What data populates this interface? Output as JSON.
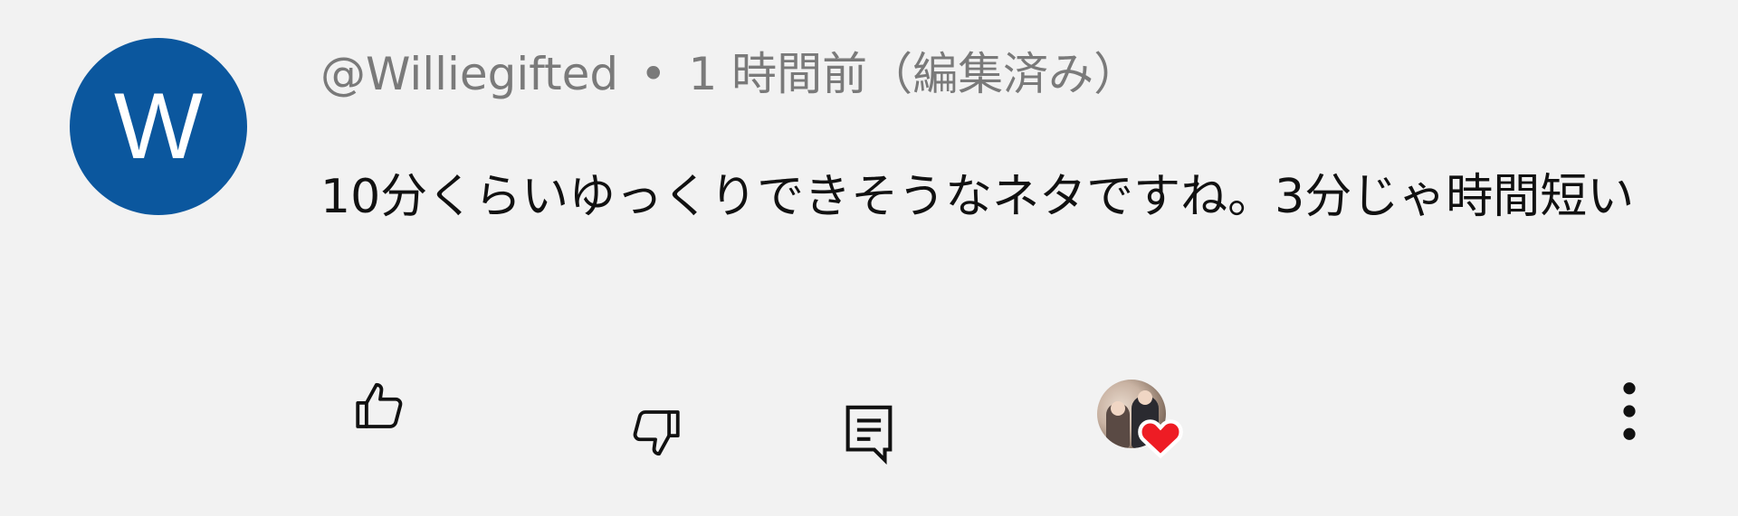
{
  "comment": {
    "avatar_letter": "W",
    "avatar_color": "#0b579e",
    "author": "@Williegifted",
    "separator": "•",
    "time": "1 時間前（編集済み）",
    "text": "10分くらいゆっくりできそうなネタですね。3分じゃ時間短い"
  },
  "actions": {
    "like_icon": "thumbs-up-icon",
    "dislike_icon": "thumbs-down-icon",
    "reply_icon": "reply-icon",
    "hearted_icon": "heart-icon",
    "heart_color": "#ee1c24",
    "more_icon": "more-vertical-icon"
  }
}
